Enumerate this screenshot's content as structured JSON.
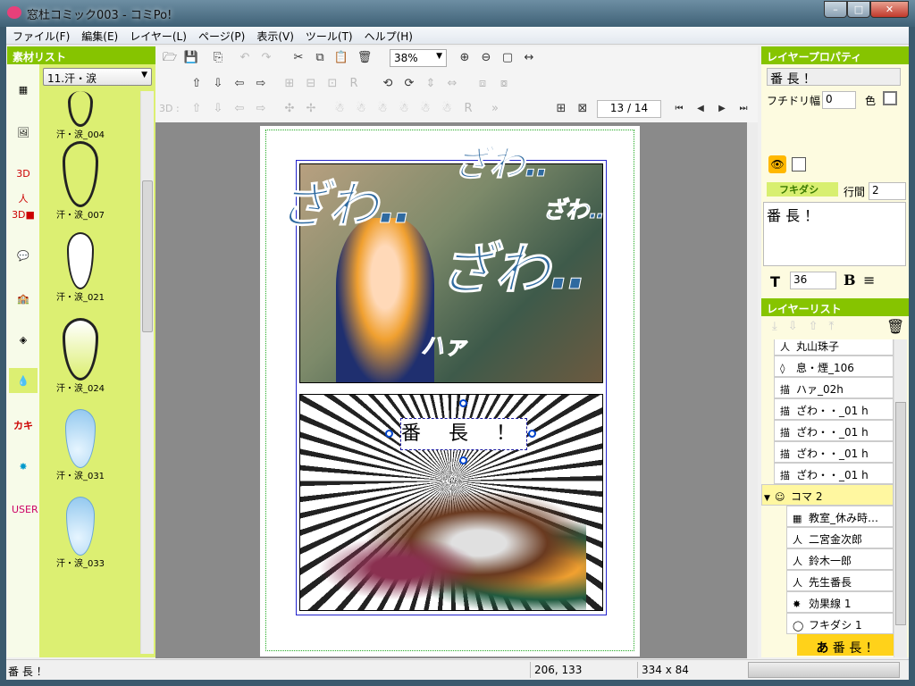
{
  "window": {
    "title": "窓杜コミック003 - コミPo!",
    "controls": [
      "–",
      "□",
      "✕"
    ]
  },
  "menu": [
    "ファイル(F)",
    "編集(E)",
    "レイヤー(L)",
    "ページ(P)",
    "表示(V)",
    "ツール(T)",
    "ヘルプ(H)"
  ],
  "materials": {
    "header": "素材リスト",
    "category": "11.汗・涙",
    "items": [
      "汗・涙_004",
      "汗・涙_007",
      "汗・涙_021",
      "汗・涙_024",
      "汗・涙_031",
      "汗・涙_033"
    ],
    "side_icons": [
      "panel-layout-icon",
      "scene-icon",
      "3d-character-icon",
      "3d-object-icon",
      "speech-balloon-icon",
      "background-icon",
      "item-icon",
      "sweat-drop-icon",
      "kakimoji-icon",
      "effect-lines-icon",
      "user-icon"
    ]
  },
  "toolbar": {
    "zoom": "38%",
    "label_3d": "3D :",
    "page_current": "13",
    "page_total": "14",
    "page_display": "13 / 14"
  },
  "comic": {
    "bubble_text": "番 長 ！",
    "sfx": [
      "ざわ‥",
      "ざわ‥",
      "ざわ‥",
      "ざわ‥",
      "ハァ"
    ]
  },
  "properties": {
    "header": "レイヤープロパティ",
    "name": "番 長 ！",
    "border_label": "フチドリ幅",
    "border_value": "0",
    "color_label": "色",
    "section": "フキダシ",
    "spacing_label": "行間",
    "spacing_value": "2",
    "text": "番 長 ！",
    "font_size": "36",
    "bold_label": "B"
  },
  "layers": {
    "header": "レイヤーリスト",
    "items": [
      {
        "icon": "人",
        "label": "丸山珠子"
      },
      {
        "icon": "◊",
        "label": "息・煙_106"
      },
      {
        "icon": "描",
        "label": "ハァ_02h"
      },
      {
        "icon": "描",
        "label": "ざわ・・_01 h"
      },
      {
        "icon": "描",
        "label": "ざわ・・_01 h"
      },
      {
        "icon": "描",
        "label": "ざわ・・_01 h"
      },
      {
        "icon": "描",
        "label": "ざわ・・_01 h"
      }
    ],
    "group": "コマ 2",
    "group_items": [
      {
        "icon": "▦",
        "label": "教室_休み時…"
      },
      {
        "icon": "人",
        "label": "二宮金次郎"
      },
      {
        "icon": "人",
        "label": "鈴木一郎"
      },
      {
        "icon": "人",
        "label": "先生番長"
      },
      {
        "icon": "✸",
        "label": "効果線 1"
      },
      {
        "icon": "◯",
        "label": "フキダシ 1"
      }
    ],
    "selected": {
      "icon": "あ",
      "label": "番 長 ！"
    }
  },
  "status": {
    "text": "番 長 ！",
    "coords": "206, 133",
    "size": "334 x 84"
  },
  "colors": {
    "accent": "#86c400",
    "material_bg": "#dcef72",
    "selected_layer": "#ffd21a",
    "group_row": "#fff7a0"
  }
}
